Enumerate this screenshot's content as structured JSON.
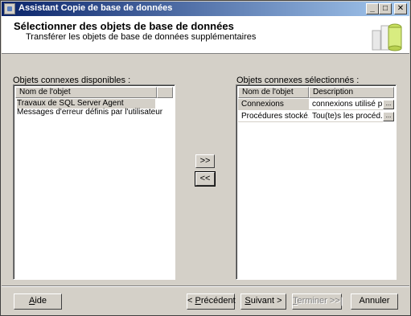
{
  "window": {
    "title": "Assistant Copie de base de données",
    "buttons": {
      "minimize": "_",
      "maximize": "□",
      "close": "✕"
    }
  },
  "header": {
    "title": "Sélectionner des objets de base de données",
    "subtitle": "Transférer les objets de base de données supplémentaires",
    "icon": "database-wizard-icon"
  },
  "available": {
    "label": "Objets connexes disponibles :",
    "column": "Nom de l'objet",
    "items": [
      {
        "name": "Travaux de SQL Server Agent",
        "selected": true
      },
      {
        "name": "Messages d'erreur définis par l'utilisateur",
        "selected": false
      }
    ]
  },
  "selected_objects": {
    "label": "Objets connexes sélectionnés :",
    "columns": [
      "Nom de l'objet",
      "Description"
    ],
    "rows": [
      {
        "name": "Connexions",
        "description": "connexions utilisé p...",
        "button": "...",
        "selected": true
      },
      {
        "name": "Procédures stocké...",
        "description": "Tou(te)s les procéd...",
        "button": "...",
        "selected": false
      }
    ]
  },
  "move_buttons": {
    "add": ">>",
    "remove": "<<"
  },
  "footer": {
    "help": {
      "accel": "A",
      "rest": "ide"
    },
    "previous": {
      "pre": "< ",
      "accel": "P",
      "rest": "récédent"
    },
    "next": {
      "accel": "S",
      "rest": "uivant >"
    },
    "finish": {
      "accel": "T",
      "rest": "erminer >>|",
      "enabled": false
    },
    "cancel": "Annuler"
  },
  "colors": {
    "titlebar_start": "#0a246a",
    "titlebar_end": "#a6caf0",
    "face": "#d4d0c8"
  }
}
